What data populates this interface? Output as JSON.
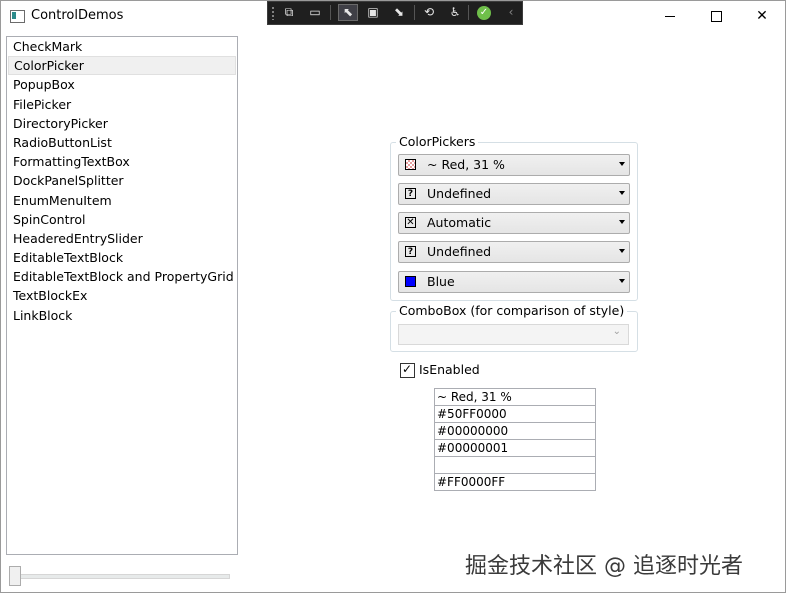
{
  "window": {
    "title": "ControlDemos",
    "icons": {
      "app": "app-window-icon",
      "minimize": "minimize-icon",
      "maximize": "maximize-icon",
      "close": "close-icon"
    },
    "close_glyph": "✕"
  },
  "debug_toolbar": {
    "icons": [
      "live-visual-tree-icon",
      "video-icon",
      "select-element-icon",
      "display-layout-adorners-icon",
      "track-focus-icon",
      "hot-reload-icon",
      "accessibility-icon",
      "check-icon",
      "collapse-chevron-icon"
    ],
    "glyphs": [
      "⧉",
      "▭",
      "⬉",
      "▣",
      "⬊",
      "⟲",
      "♿",
      "✓",
      "‹"
    ]
  },
  "sidebar": {
    "items": [
      {
        "label": "CheckMark"
      },
      {
        "label": "ColorPicker",
        "selected": true
      },
      {
        "label": "PopupBox"
      },
      {
        "label": "FilePicker"
      },
      {
        "label": "DirectoryPicker"
      },
      {
        "label": "RadioButtonList"
      },
      {
        "label": "FormattingTextBox"
      },
      {
        "label": "DockPanelSplitter"
      },
      {
        "label": "EnumMenuItem"
      },
      {
        "label": "SpinControl"
      },
      {
        "label": "HeaderedEntrySlider"
      },
      {
        "label": "EditableTextBlock"
      },
      {
        "label": "EditableTextBlock and PropertyGrid"
      },
      {
        "label": "TextBlockEx"
      },
      {
        "label": "LinkBlock"
      }
    ]
  },
  "slider": {
    "value": 0
  },
  "color_pickers": {
    "header": "ColorPickers",
    "items": [
      {
        "label": "~ Red, 31 %",
        "swatch": "checker",
        "swatch_glyph": ""
      },
      {
        "label": "Undefined",
        "swatch": "question",
        "swatch_glyph": "?"
      },
      {
        "label": "Automatic",
        "swatch": "cross",
        "swatch_glyph": "✕"
      },
      {
        "label": "Undefined",
        "swatch": "question",
        "swatch_glyph": "?"
      },
      {
        "label": "Blue",
        "swatch": "solid",
        "swatch_glyph": "",
        "color": "#0000ff"
      }
    ]
  },
  "combobox": {
    "header": "ComboBox (for comparison of style)",
    "value": ""
  },
  "is_enabled": {
    "label": "IsEnabled",
    "checked": true,
    "mark": "✓"
  },
  "values": [
    "~ Red, 31 %",
    "#50FF0000",
    "#00000000",
    "#00000001",
    "",
    "#FF0000FF"
  ],
  "watermark": "掘金技术社区 @ 追逐时光者"
}
